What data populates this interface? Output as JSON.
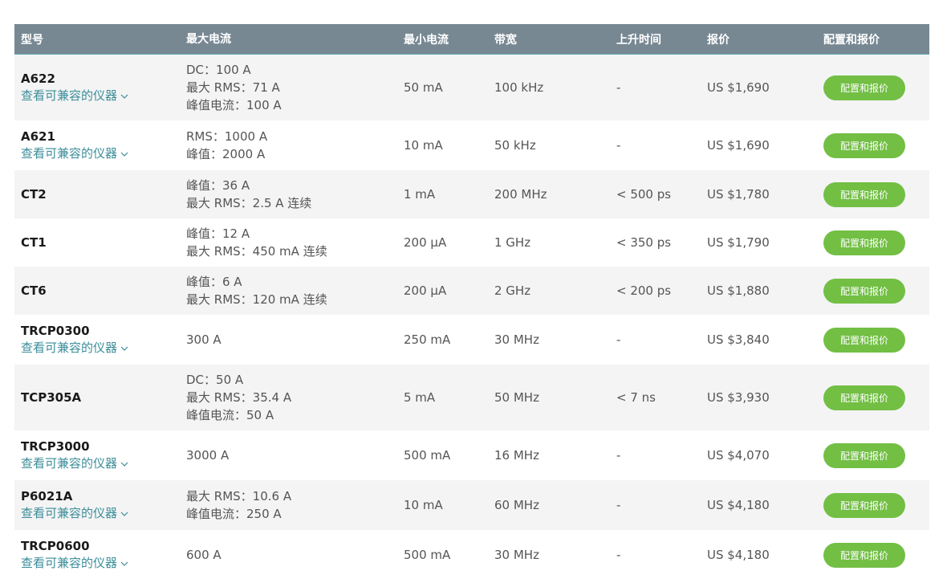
{
  "header": {
    "model": "型号",
    "max_current": "最大电流",
    "min_current": "最小电流",
    "bandwidth": "带宽",
    "rise_time": "上升时间",
    "price": "报价",
    "configure": "配置和报价"
  },
  "compat_label": "查看可兼容的仪器",
  "button_label": "配置和报价",
  "colors": {
    "header_bg": "#778893",
    "button": "#72bf44",
    "link": "#3b8d99",
    "alt_row": "#f4f4f4"
  },
  "icons": {
    "compat_chevron": "chevron-down-icon"
  },
  "rows": [
    {
      "model": "A622",
      "compat": true,
      "specs": [
        "DC：100 A",
        "最大 RMS：71 A",
        "峰值电流：100 A"
      ],
      "min": "50 mA",
      "bw": "100 kHz",
      "rise": "-",
      "price": "US $1,690"
    },
    {
      "model": "A621",
      "compat": true,
      "specs": [
        "RMS：1000 A",
        "峰值：2000 A"
      ],
      "min": "10 mA",
      "bw": "50 kHz",
      "rise": "-",
      "price": "US $1,690"
    },
    {
      "model": "CT2",
      "compat": false,
      "specs": [
        "峰值：36 A",
        "最大 RMS：2.5 A 连续"
      ],
      "min": "1 mA",
      "bw": "200 MHz",
      "rise": "< 500 ps",
      "price": "US $1,780"
    },
    {
      "model": "CT1",
      "compat": false,
      "specs": [
        "峰值：12 A",
        "最大 RMS：450 mA 连续"
      ],
      "min": "200 µA",
      "bw": "1 GHz",
      "rise": "< 350 ps",
      "price": "US $1,790"
    },
    {
      "model": "CT6",
      "compat": false,
      "specs": [
        "峰值：6 A",
        "最大 RMS：120 mA 连续"
      ],
      "min": "200 µA",
      "bw": "2 GHz",
      "rise": "< 200 ps",
      "price": "US $1,880"
    },
    {
      "model": "TRCP0300",
      "compat": true,
      "specs": [
        "300 A"
      ],
      "min": "250 mA",
      "bw": "30 MHz",
      "rise": "-",
      "price": "US $3,840"
    },
    {
      "model": "TCP305A",
      "compat": false,
      "specs": [
        "DC：50 A",
        "最大 RMS：35.4 A",
        "峰值电流：50 A"
      ],
      "min": "5 mA",
      "bw": "50 MHz",
      "rise": "< 7 ns",
      "price": "US $3,930"
    },
    {
      "model": "TRCP3000",
      "compat": true,
      "specs": [
        "3000 A"
      ],
      "min": "500 mA",
      "bw": "16 MHz",
      "rise": "-",
      "price": "US $4,070"
    },
    {
      "model": "P6021A",
      "compat": true,
      "specs": [
        "最大 RMS：10.6 A",
        "峰值电流：250 A"
      ],
      "min": "10 mA",
      "bw": "60 MHz",
      "rise": "-",
      "price": "US $4,180"
    },
    {
      "model": "TRCP0600",
      "compat": true,
      "specs": [
        "600 A"
      ],
      "min": "500 mA",
      "bw": "30 MHz",
      "rise": "-",
      "price": "US $4,180"
    }
  ]
}
